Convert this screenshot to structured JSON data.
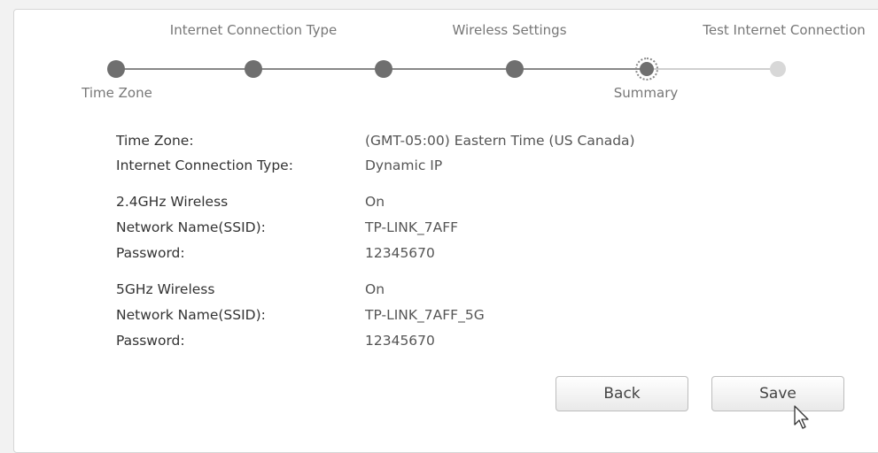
{
  "wizard": {
    "steps_top": [
      {
        "label": "Internet Connection Type"
      },
      {
        "label": "Wireless Settings"
      },
      {
        "label": "Test Internet Connection"
      }
    ],
    "steps_bottom": [
      {
        "label": "Time Zone"
      },
      {
        "label": "Summary"
      }
    ],
    "progress": {
      "total_steps": 6,
      "completed_steps": 4,
      "current_step_label": "Summary"
    }
  },
  "summary": {
    "general": [
      {
        "label": "Time Zone:",
        "value": "(GMT-05:00) Eastern Time (US Canada)"
      },
      {
        "label": "Internet Connection Type:",
        "value": "Dynamic IP"
      }
    ],
    "wireless_24": [
      {
        "label": "2.4GHz Wireless",
        "value": "On"
      },
      {
        "label": "Network Name(SSID):",
        "value": "TP-LINK_7AFF"
      },
      {
        "label": "Password:",
        "value": "12345670"
      }
    ],
    "wireless_5": [
      {
        "label": "5GHz Wireless",
        "value": "On"
      },
      {
        "label": "Network Name(SSID):",
        "value": "TP-LINK_7AFF_5G"
      },
      {
        "label": "Password:",
        "value": "12345670"
      }
    ]
  },
  "buttons": {
    "back_label": "Back",
    "save_label": "Save"
  },
  "colors": {
    "step_done": "#6f6f6f",
    "step_pending": "#d8d8d8",
    "text_label": "#333333",
    "text_value": "#555555"
  }
}
